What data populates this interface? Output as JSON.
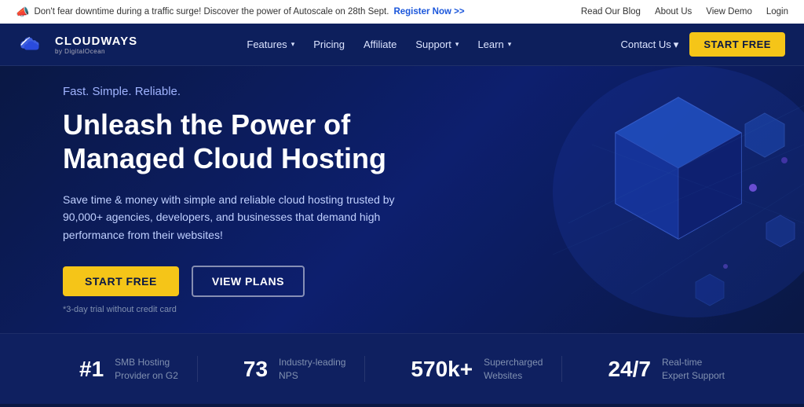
{
  "announcement": {
    "message": "Don't fear downtime during a traffic surge! Discover the power of Autoscale on 28th Sept.",
    "cta_text": "Register Now >>",
    "right_links": [
      "Read Our Blog",
      "About Us",
      "View Demo",
      "Login"
    ]
  },
  "nav": {
    "logo_name": "CLOUDWAYS",
    "logo_sub": "by DigitalOcean",
    "links": [
      {
        "label": "Features",
        "has_dropdown": true
      },
      {
        "label": "Pricing",
        "has_dropdown": false
      },
      {
        "label": "Affiliate",
        "has_dropdown": false
      },
      {
        "label": "Support",
        "has_dropdown": true
      },
      {
        "label": "Learn",
        "has_dropdown": true
      }
    ],
    "contact_us": "Contact Us",
    "start_free": "START FREE"
  },
  "hero": {
    "tagline": "Fast. Simple. Reliable.",
    "title": "Unleash the Power of\nManaged Cloud Hosting",
    "description": "Save time & money with simple and reliable cloud hosting trusted by 90,000+ agencies, developers, and businesses that demand high performance from their websites!",
    "btn_start": "START FREE",
    "btn_plans": "VIEW PLANS",
    "trial_note": "*3-day trial without credit card"
  },
  "stats": [
    {
      "number": "#1",
      "desc": "SMB Hosting\nProvider on G2"
    },
    {
      "number": "73",
      "desc": "Industry-leading\nNPS"
    },
    {
      "number": "570k+",
      "desc": "Supercharged\nWebsites"
    },
    {
      "number": "24/7",
      "desc": "Real-time\nExpert Support"
    }
  ]
}
